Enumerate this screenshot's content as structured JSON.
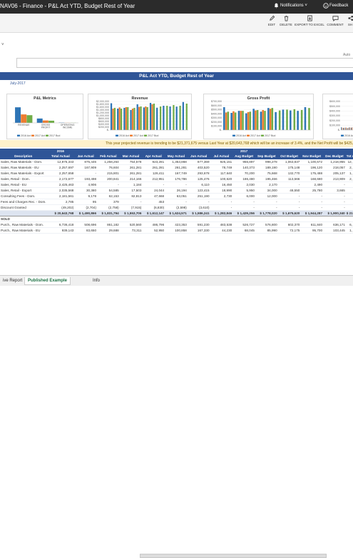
{
  "app": {
    "title": "NAV06 - Finance - P&L Act YTD, Budget Rest of Year",
    "notifications_label": "Notifications",
    "feedback_label": "Feedback"
  },
  "commands": [
    {
      "label": "EDIT",
      "icon": "pencil-icon"
    },
    {
      "label": "DELETE",
      "icon": "trash-icon"
    },
    {
      "label": "EXPORT TO EXCEL",
      "icon": "excel-export-icon"
    },
    {
      "label": "COMMENT",
      "icon": "comment-icon"
    },
    {
      "label": "SH",
      "icon": "share-icon"
    }
  ],
  "filter_pane": {
    "collapse_caret": "˅",
    "auto_label": "Auto"
  },
  "report": {
    "title": "P&L Act YTD, Budget Rest of Year",
    "date": "July-2017",
    "trend_text": "This year projected revenue is trending to be $21,371,675 versus Last Year at $20,643,768 which will be  an increase of 3.4%, and the Net Profit will be $425,446, which will be an increase"
  },
  "chart_data": [
    {
      "type": "bar",
      "title": "P&L Metrics",
      "categories": [
        "REVENUE",
        "GROSS PROFIT",
        "OPERATING INCOME"
      ],
      "series": [
        {
          "name": "2016 Act",
          "values": [
            20.6,
            5.8,
            0.4
          ]
        },
        {
          "name": "2017 Act",
          "values": [
            11.2,
            3.2,
            0.2
          ]
        },
        {
          "name": "2017 Bud",
          "values": [
            10.2,
            2.9,
            0.2
          ]
        }
      ],
      "legend": "bottom",
      "colors": [
        "#2e75b6",
        "#ed7d31",
        "#70ad47"
      ]
    },
    {
      "type": "bar",
      "title": "Revenue",
      "categories": [
        "1",
        "2",
        "3",
        "4",
        "5",
        "6",
        "7",
        "8",
        "9",
        "10",
        "11",
        "12"
      ],
      "series": [
        {
          "name": "2016 Act",
          "values": [
            1875,
            1500,
            1550,
            1400,
            1800,
            1580,
            1900,
            1560,
            1700,
            1650,
            1640,
            1960
          ]
        },
        {
          "name": "2017 Act",
          "values": [
            1500,
            1580,
            1600,
            1500,
            1620,
            1650,
            1800,
            0,
            0,
            0,
            0,
            0
          ]
        },
        {
          "name": "2017 Bud",
          "values": [
            1550,
            1500,
            1600,
            1550,
            1650,
            1600,
            1850,
            1650,
            1700,
            1750,
            1700,
            1850
          ]
        }
      ],
      "yticks": [
        "$2,000,000",
        "$1,800,000",
        "$1,600,000",
        "$1,400,000",
        "$1,200,000",
        "$1,000,000",
        "$800,000",
        "$600,000",
        "$400,000",
        "$200,000",
        "$-"
      ],
      "ylim": [
        0,
        2000
      ],
      "legend": "bottom",
      "colors": [
        "#2e75b6",
        "#ed7d31",
        "#70ad47"
      ]
    },
    {
      "type": "bar",
      "title": "Gross Profit",
      "categories": [
        "1",
        "2",
        "3",
        "4",
        "5",
        "6",
        "7",
        "8",
        "9",
        "10",
        "11",
        "12"
      ],
      "series": [
        {
          "name": "2016 Act",
          "values": [
            560,
            420,
            470,
            410,
            520,
            450,
            540,
            440,
            500,
            480,
            470,
            560
          ]
        },
        {
          "name": "2017 Act",
          "values": [
            430,
            460,
            470,
            440,
            480,
            490,
            520,
            0,
            0,
            0,
            0,
            0
          ]
        },
        {
          "name": "2017 Bud",
          "values": [
            450,
            430,
            470,
            450,
            490,
            470,
            540,
            480,
            500,
            510,
            490,
            540
          ]
        }
      ],
      "yticks": [
        "$700,000",
        "$600,000",
        "$500,000",
        "$400,000",
        "$300,000",
        "$200,000",
        "$100,000",
        "$-"
      ],
      "ylim": [
        0,
        700
      ],
      "legend": "bottom",
      "colors": [
        "#2e75b6",
        "#ed7d31",
        "#70ad47"
      ]
    },
    {
      "type": "bar",
      "title": "",
      "categories": [
        "1",
        "2",
        "3",
        "4",
        "5",
        "6",
        "7",
        "8",
        "9",
        "10",
        "11",
        "12"
      ],
      "series": [
        {
          "name": "2016 Act",
          "values": [
            60,
            45,
            50,
            40,
            55,
            50,
            60,
            48,
            52,
            50,
            49,
            58
          ]
        },
        {
          "name": "2017 Act",
          "values": [
            50,
            48,
            52,
            46,
            54,
            53,
            57,
            0,
            0,
            0,
            0,
            0
          ]
        }
      ],
      "yticks": [
        "$600,000",
        "$500,000",
        "$400,000",
        "$300,000",
        "$200,000",
        "$100,000",
        "$-"
      ],
      "ylim": [
        0,
        600
      ],
      "legend": "bottom",
      "colors": [
        "#2e75b6",
        "#ed7d31",
        "#70ad47"
      ]
    }
  ],
  "table": {
    "year_row": [
      "",
      "2016",
      "",
      "",
      "",
      "",
      "",
      "",
      "",
      "2017",
      "",
      "",
      "",
      "",
      ""
    ],
    "header_row": [
      "Description",
      "Total Actual",
      "Jan Actual",
      "Feb Actual",
      "Mar Actual",
      "Apr Actual",
      "May Actual",
      "Jun Actual",
      "Jul Actual",
      "Aug Budget",
      "Sep Budget",
      "Oct Budget",
      "Nov Budget",
      "Dec Budget",
      "Tot Act +"
    ],
    "rows": [
      {
        "type": "data",
        "cells": [
          "Sales, Raw Materials - Dom.",
          "12,875,343",
          "875,446",
          "1,258,264",
          "754,578",
          "923,281",
          "1,353,868",
          "877,369",
          "925,151",
          "956,897",
          "998,278",
          "1,063,837",
          "1,100,672",
          "1,218,955",
          "12,"
        ]
      },
      {
        "type": "data",
        "cells": [
          "Sales, Raw Materials - EU",
          "2,257,697",
          "167,909",
          "76,604",
          "261,281",
          "261,281",
          "261,281",
          "403,520",
          "78,749",
          "140,373",
          "189,190",
          "175,148",
          "196,120",
          "218,057",
          "2,"
        ]
      },
      {
        "type": "data",
        "cells": [
          "Sales, Raw Materials - Export",
          "2,257,658",
          "-",
          "215,801",
          "261,281",
          "126,411",
          "167,749",
          "293,678",
          "117,640",
          "70,200",
          "75,668",
          "132,770",
          "175,488",
          "205,137",
          "1,"
        ]
      },
      {
        "type": "data",
        "cells": [
          "Sales, Retail - Dom.",
          "2,172,677",
          "193,498",
          "200,841",
          "214,166",
          "212,951",
          "176,786",
          "125,476",
          "100,620",
          "186,480",
          "195,466",
          "113,566",
          "168,680",
          "213,909",
          "2,"
        ]
      },
      {
        "type": "data",
        "cells": [
          "Sales, Retail - EU",
          "2,425,463",
          "4,906",
          "-",
          "1,184",
          "-",
          "-",
          "6,110",
          "16,450",
          "2,030",
          "2,170",
          "-",
          "2,490",
          "-",
          ""
        ]
      },
      {
        "type": "data",
        "cells": [
          "Sales, Retail - Export",
          "2,035,568",
          "30,380",
          "54,585",
          "17,503",
          "24,044",
          "26,194",
          "123,415",
          "18,990",
          "5,950",
          "34,000",
          "48,550",
          "25,780",
          "3,665",
          ""
        ]
      },
      {
        "type": "data",
        "cells": [
          "Consulting Fees - Dom.",
          "2,181,561",
          "9,178",
          "62,153",
          "82,813",
          "47,668",
          "63,051",
          "251,190",
          "2,730",
          "6,000",
          "12,000",
          "-",
          "-",
          "-",
          ""
        ]
      },
      {
        "type": "data",
        "cells": [
          "Fees and Charges Rec. - Dom.",
          "2,785",
          "95",
          "379",
          "-",
          "453",
          "-",
          "-",
          "-",
          "-",
          "-",
          "-",
          "-",
          "-",
          ""
        ]
      },
      {
        "type": "data",
        "cells": [
          "Discount Granted",
          "(49,202)",
          "(2,704)",
          "(2,758)",
          "(7,915)",
          "(6,830)",
          "(2,598)",
          "(3,610)",
          "-",
          "-",
          "-",
          "-",
          "-",
          "-",
          ""
        ]
      },
      {
        "type": "total",
        "cells": [
          "",
          "$ 20,643,768",
          "$ 1,490,866",
          "$ 1,831,794",
          "$ 1,553,706",
          "$ 1,612,147",
          "$ 1,624,571",
          "$ 1,586,241",
          "$ 1,282,846",
          "$ 1,429,256",
          "$ 1,778,020",
          "$ 1,675,620",
          "$ 1,944,287",
          "$ 1,900,340",
          "$ 21,"
        ]
      },
      {
        "type": "section",
        "cells": [
          "SOLD",
          "",
          "",
          "",
          "",
          "",
          "",
          "",
          "",
          "",
          "",
          "",
          "",
          "",
          ""
        ]
      },
      {
        "type": "data",
        "cells": [
          "Purch., Raw Materials - Dom.",
          "6,736,418",
          "508,696",
          "861,182",
          "520,560",
          "486,796",
          "423,353",
          "591,230",
          "483,538",
          "526,727",
          "576,800",
          "602,370",
          "611,840",
          "636,171",
          "6,"
        ]
      },
      {
        "type": "data",
        "cells": [
          "Purch., Raw Materials - EU",
          "939,143",
          "83,650",
          "29,688",
          "73,311",
          "52,950",
          "100,858",
          "167,330",
          "44,230",
          "68,045",
          "85,990",
          "72,175",
          "95,700",
          "103,445",
          "1,"
        ]
      }
    ]
  },
  "tabs": [
    {
      "label": "ive Report",
      "active": false
    },
    {
      "label": "Published Example",
      "active": true
    },
    {
      "label": "Info",
      "active": false
    }
  ]
}
